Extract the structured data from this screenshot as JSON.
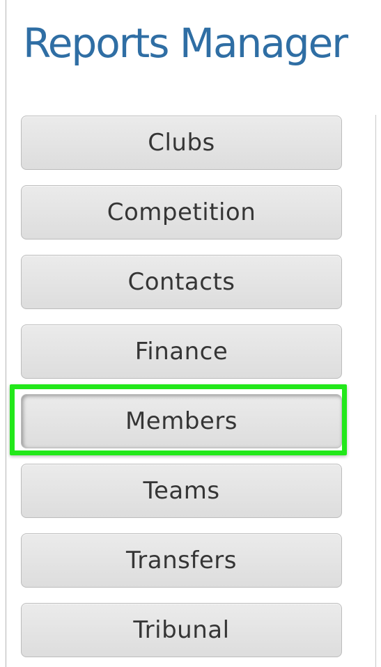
{
  "page": {
    "title": "Reports Manager"
  },
  "report_categories": [
    {
      "label": "Clubs",
      "selected": false
    },
    {
      "label": "Competition",
      "selected": false
    },
    {
      "label": "Contacts",
      "selected": false
    },
    {
      "label": "Finance",
      "selected": false
    },
    {
      "label": "Members",
      "selected": true
    },
    {
      "label": "Teams",
      "selected": false
    },
    {
      "label": "Transfers",
      "selected": false
    },
    {
      "label": "Tribunal",
      "selected": false
    }
  ],
  "colors": {
    "title": "#2f6ea4",
    "highlight": "#22e81a",
    "button_text": "#353535"
  }
}
